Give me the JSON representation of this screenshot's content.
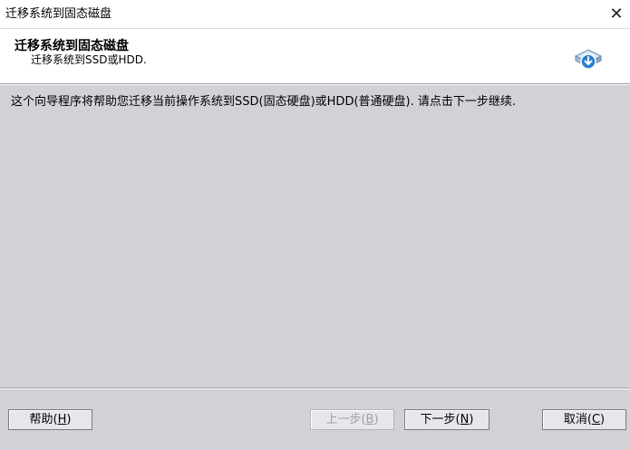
{
  "window": {
    "title": "迁移系统到固态磁盘",
    "close_glyph": "✕"
  },
  "header": {
    "title": "迁移系统到固态磁盘",
    "subtitle": "迁移系统到SSD或HDD.",
    "icon": "disk-migrate-icon"
  },
  "main": {
    "description": "这个向导程序将帮助您迁移当前操作系统到SSD(固态硬盘)或HDD(普通硬盘). 请点击下一步继续."
  },
  "buttons": {
    "help": {
      "label": "帮助(",
      "key": "H",
      "end": ")"
    },
    "prev": {
      "label": "上一步(",
      "key": "B",
      "end": ")"
    },
    "next": {
      "label": "下一步(",
      "key": "N",
      "end": ")"
    },
    "cancel": {
      "label": "取消(",
      "key": "C",
      "end": ")"
    }
  },
  "colors": {
    "background": "#d4d0d8",
    "header_bg": "#ffffff",
    "icon_blue": "#2a7fd0"
  }
}
